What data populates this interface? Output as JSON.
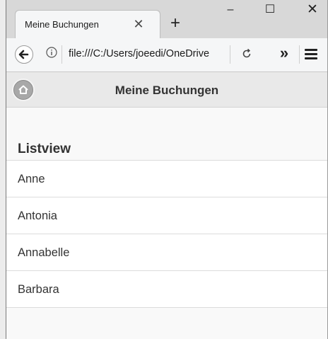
{
  "browser": {
    "tab_title": "Meine Buchungen",
    "tab_close_glyph": "✕",
    "new_tab_glyph": "+",
    "url": "file:///C:/Users/joeedi/OneDrive",
    "window_controls": {
      "minimize": "–",
      "maximize": "☐",
      "close": "✕"
    },
    "icons": [
      "back-arrow-icon",
      "info-icon",
      "reload-icon",
      "overflow-chevron-icon",
      "hamburger-menu-icon"
    ]
  },
  "app": {
    "header_title": "Meine Buchungen",
    "home_icon": "home-icon",
    "list_heading": "Listview",
    "items": [
      {
        "label": "Anne"
      },
      {
        "label": "Antonia"
      },
      {
        "label": "Annabelle"
      },
      {
        "label": "Barbara"
      }
    ]
  },
  "colors": {
    "tab_bar": "#d8d8d8",
    "toolbar": "#f5f6f7",
    "app_header": "#e9e9e9",
    "text": "#333333"
  }
}
